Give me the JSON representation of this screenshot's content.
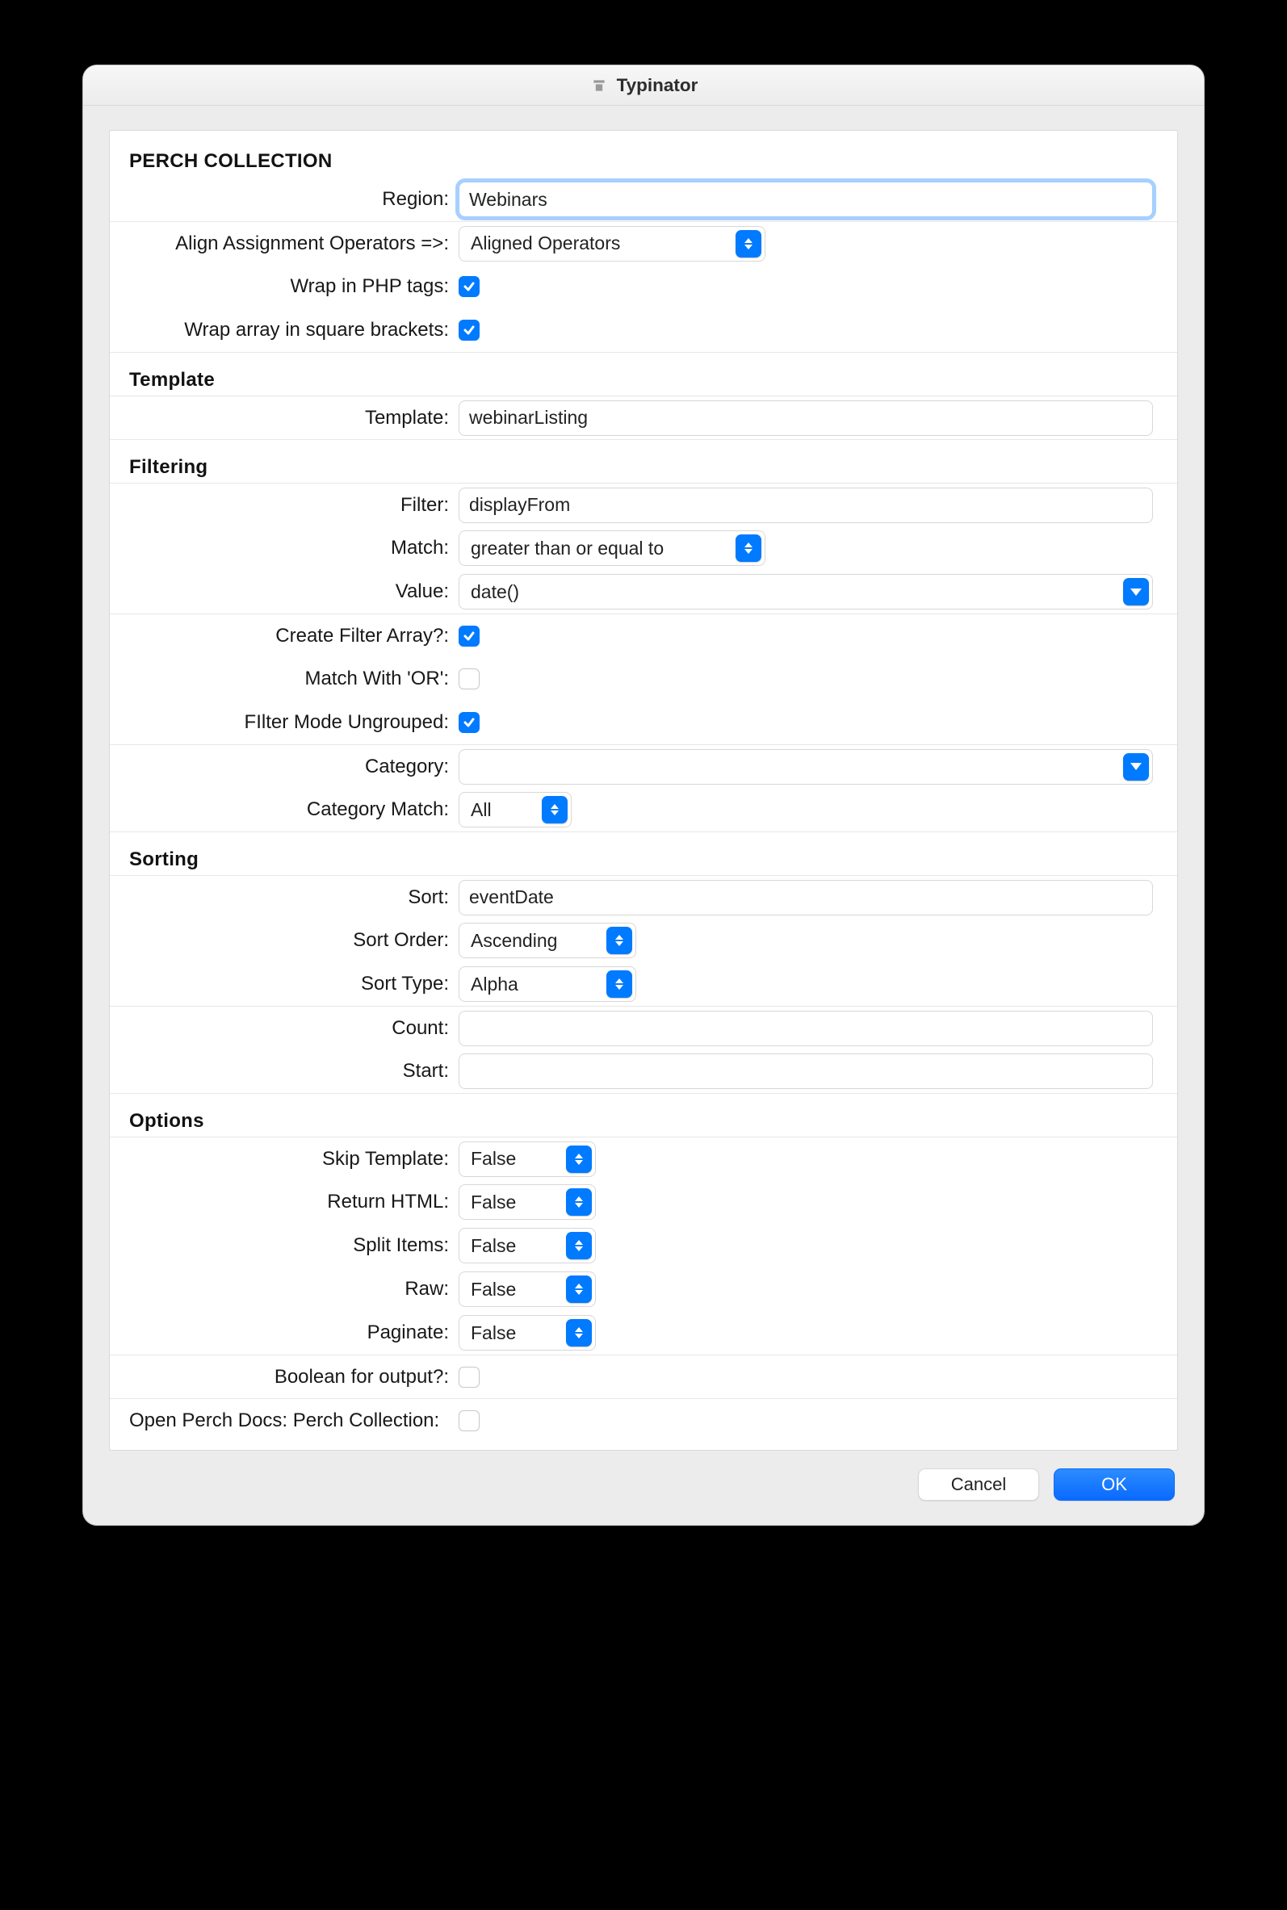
{
  "window": {
    "title": "Typinator"
  },
  "collection": {
    "heading": "Perch Collection",
    "region_label": "Region:",
    "region_value": "Webinars",
    "align_label": "Align Assignment Operators =>:",
    "align_value": "Aligned Operators",
    "php_label": "Wrap in PHP tags:",
    "php_checked": true,
    "brackets_label": "Wrap array in square brackets:",
    "brackets_checked": true
  },
  "template": {
    "heading": "Template",
    "template_label": "Template:",
    "template_value": "webinarListing"
  },
  "filtering": {
    "heading": "Filtering",
    "filter_label": "Filter:",
    "filter_value": "displayFrom",
    "match_label": "Match:",
    "match_value": "greater than or equal to",
    "value_label": "Value:",
    "value_value": "date()",
    "create_array_label": "Create Filter Array?:",
    "create_array_checked": true,
    "match_or_label": "Match With 'OR':",
    "match_or_checked": false,
    "ungrouped_label": "FIlter Mode Ungrouped:",
    "ungrouped_checked": true,
    "category_label": "Category:",
    "category_value": "",
    "category_match_label": "Category Match:",
    "category_match_value": "All"
  },
  "sorting": {
    "heading": "Sorting",
    "sort_label": "Sort:",
    "sort_value": "eventDate",
    "order_label": "Sort Order:",
    "order_value": "Ascending",
    "type_label": "Sort Type:",
    "type_value": "Alpha",
    "count_label": "Count:",
    "count_value": "",
    "start_label": "Start:",
    "start_value": ""
  },
  "options": {
    "heading": "Options",
    "skip_label": "Skip Template:",
    "skip_value": "False",
    "return_label": "Return HTML:",
    "return_value": "False",
    "split_label": "Split Items:",
    "split_value": "False",
    "raw_label": "Raw:",
    "raw_value": "False",
    "paginate_label": "Paginate:",
    "paginate_value": "False",
    "boolean_label": "Boolean for output?:",
    "boolean_checked": false,
    "docs_label": "Open Perch Docs: Perch Collection:",
    "docs_checked": false
  },
  "footer": {
    "cancel": "Cancel",
    "ok": "OK"
  }
}
